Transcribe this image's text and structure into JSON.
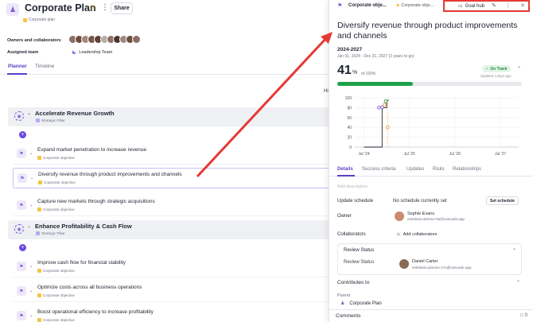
{
  "plan": {
    "title": "Corporate Plan",
    "tag": "Corporate plan",
    "share_label": "Share",
    "owners_label": "Owners and collaborators",
    "assigned_team_label": "Assigned team",
    "team_name": "Leadership Team",
    "avatar_colors": [
      "#8d6e63",
      "#6d4c41",
      "#a1887f",
      "#795548",
      "#5d4037",
      "#bcaaa4",
      "#8d6e63",
      "#4e342e",
      "#a1887f",
      "#6d4c41",
      "#8d6e63"
    ]
  },
  "tabs": [
    {
      "label": "Planner"
    },
    {
      "label": "Timeline"
    }
  ],
  "hi_text": "Hi",
  "pillars": [
    {
      "title": "Accelerate Revenue Growth",
      "tag": "Strategic Pillar",
      "objectives": [
        {
          "title": "Expand market penetration to increase revenue",
          "tag": "Corporate objective"
        },
        {
          "title": "Diversify revenue through product improvements and channels",
          "tag": "Corporate objective"
        },
        {
          "title": "Capture new markets through strategic acquisitions",
          "tag": "Corporate objective"
        }
      ]
    },
    {
      "title": "Enhance Profitability & Cash Flow",
      "tag": "Strategic Pillar",
      "objectives": [
        {
          "title": "Improve cash flow for financial stability",
          "tag": "Corporate objective"
        },
        {
          "title": "Optimize costs across all business operations",
          "tag": "Corporate objective"
        },
        {
          "title": "Boost operational efficiency to increase profitability",
          "tag": "Corporate objective"
        }
      ]
    }
  ],
  "detail": {
    "crumb1": "Corporate obje...",
    "crumb2": "Corporate obje...",
    "goal_hub": "Goal hub",
    "title": "Diversify revenue through product improvements and channels",
    "period": "2024-2027",
    "dates": "Jan 01, 2024 - Dec 31, 2027  (3 years to go)",
    "percent": "41",
    "percent_unit": "%",
    "of_text": "of 100%",
    "progress": 0.41,
    "status": "On Track",
    "status_color": "#1e8a42",
    "updated": "Updated 4 days ago",
    "tabs": [
      {
        "label": "Details"
      },
      {
        "label": "Success criteria"
      },
      {
        "label": "Updates"
      },
      {
        "label": "Risks"
      },
      {
        "label": "Relationships"
      }
    ],
    "add_description": "Add description",
    "update_schedule_label": "Update schedule",
    "update_schedule_value": "No schedule currently set",
    "set_schedule": "Set schedule",
    "owner_label": "Owner",
    "owner_name": "Sophie Evans",
    "owner_email": "estefania.alonso+5a@cascade.app",
    "collaborators_label": "Collaborators",
    "add_collaborators": "Add collaborators",
    "review_status_title": "Review Status",
    "review_status_label": "Review Status",
    "reviewer_name": "Daniel Carter",
    "reviewer_email": "estefania.alonso+17a@cascade.app",
    "contributes_to": "Contributes to",
    "parent_label": "Parent",
    "parent_value": "Corporate Plan",
    "comments_label": "Comments",
    "comments_count": "0"
  },
  "chart_data": {
    "type": "line",
    "yticks": [
      0,
      20,
      40,
      60,
      80,
      100
    ],
    "xticks": [
      "Jul '24",
      "Jul '25",
      "Jul '26",
      "Jul '27"
    ],
    "ylim": [
      0,
      100
    ],
    "grid": true,
    "series": [
      {
        "points": [
          [
            2024.5,
            0
          ],
          [
            2024.9,
            0
          ],
          [
            2024.9,
            80
          ],
          [
            2025.0,
            80
          ],
          [
            2025.0,
            95
          ],
          [
            2025.05,
            95
          ]
        ],
        "color": "#1f2430"
      }
    ],
    "markers": [
      {
        "x": 2024.83,
        "y": 80,
        "color": "#7c5cd6"
      },
      {
        "x": 2024.9,
        "y": 81,
        "color": "#7c5cd6"
      },
      {
        "x": 2024.95,
        "y": 86,
        "color": "#f0a040"
      },
      {
        "x": 2024.98,
        "y": 93,
        "color": "#1ea14b"
      },
      {
        "x": 2025.02,
        "y": 40,
        "color": "#f0a040"
      }
    ]
  }
}
